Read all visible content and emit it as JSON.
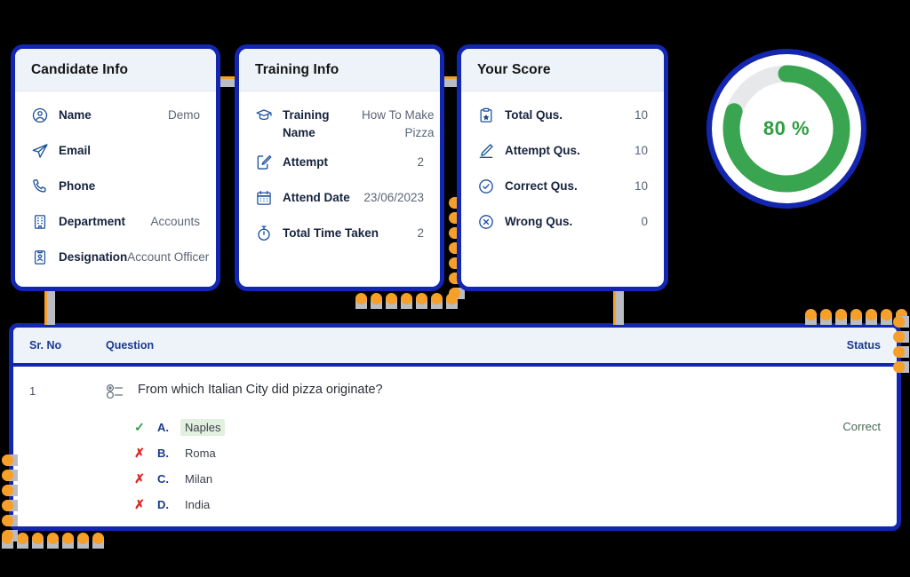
{
  "theme": {
    "border_blue": "#1226b0",
    "header_bg": "#eef2f9",
    "accent_orange": "#f6a02a",
    "green": "#2f9e41",
    "red": "#e02424",
    "label_blue": "#1a3a8f"
  },
  "cards": [
    {
      "id": "candidate-info",
      "title": "Candidate Info",
      "rows": [
        {
          "icon": "user-circle-icon",
          "label": "Name",
          "value": "Demo"
        },
        {
          "icon": "send-icon",
          "label": "Email",
          "value": ""
        },
        {
          "icon": "phone-icon",
          "label": "Phone",
          "value": ""
        },
        {
          "icon": "building-icon",
          "label": "Department",
          "value": "Accounts"
        },
        {
          "icon": "id-badge-icon",
          "label": "Designation",
          "value": "Account Officer"
        }
      ]
    },
    {
      "id": "training-info",
      "title": "Training Info",
      "rows": [
        {
          "icon": "graduation-cap-icon",
          "label": "Training Name",
          "value": "How To Make Pizza"
        },
        {
          "icon": "edit-square-icon",
          "label": "Attempt",
          "value": "2"
        },
        {
          "icon": "calendar-icon",
          "label": "Attend Date",
          "value": "23/06/2023"
        },
        {
          "icon": "stopwatch-icon",
          "label": "Total Time Taken",
          "value": "2"
        }
      ]
    },
    {
      "id": "your-score",
      "title": "Your Score",
      "rows": [
        {
          "icon": "clipboard-star-icon",
          "label": "Total Qus.",
          "value": "10"
        },
        {
          "icon": "pencil-icon",
          "label": "Attempt Qus.",
          "value": "10"
        },
        {
          "icon": "check-circle-icon",
          "label": "Correct Qus.",
          "value": "10"
        },
        {
          "icon": "x-circle-icon",
          "label": "Wrong Qus.",
          "value": "0"
        }
      ]
    }
  ],
  "gauge": {
    "label": "80 %",
    "percent": 80,
    "track_color": "#e6e8ea",
    "arc_color": "#3aa council"
  },
  "table": {
    "columns": {
      "srno": "Sr. No",
      "question": "Question",
      "status": "Status"
    },
    "rows": [
      {
        "srno": "1",
        "question_icon": "radio-list-icon",
        "question": "From which Italian City did pizza originate?",
        "status": "Correct",
        "options": [
          {
            "mark": "check",
            "letter": "A.",
            "text": "Naples",
            "highlight": true
          },
          {
            "mark": "cross",
            "letter": "B.",
            "text": "Roma",
            "highlight": false
          },
          {
            "mark": "cross",
            "letter": "C.",
            "text": "Milan",
            "highlight": false
          },
          {
            "mark": "cross",
            "letter": "D.",
            "text": "India",
            "highlight": false
          }
        ]
      }
    ]
  }
}
